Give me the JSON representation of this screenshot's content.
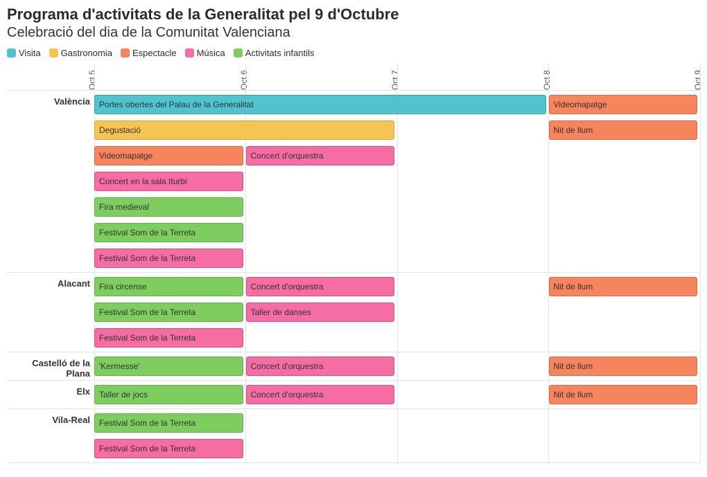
{
  "title": "Programa d'activitats de la Generalitat pel 9 d'Octubre",
  "subtitle": "Celebració del dia de la Comunitat Valenciana",
  "legend": [
    {
      "key": "Visita",
      "label": "Visita"
    },
    {
      "key": "Gastronomia",
      "label": "Gastronomia"
    },
    {
      "key": "Espectacle",
      "label": "Espectacle"
    },
    {
      "key": "Música",
      "label": "Música"
    },
    {
      "key": "Activitats",
      "label": "Activitats infantils"
    }
  ],
  "chart_data": {
    "type": "gantt",
    "x": {
      "min": 5,
      "max": 9,
      "ticks": [
        {
          "value": 5,
          "label": "Oct 5"
        },
        {
          "value": 6,
          "label": "Oct 6"
        },
        {
          "value": 7,
          "label": "Oct 7"
        },
        {
          "value": 8,
          "label": "Oct 8"
        },
        {
          "value": 9,
          "label": "Oct 9"
        }
      ]
    },
    "cities": [
      {
        "name": "València",
        "lanes": [
          [
            {
              "label": "Portes obertes del Palau de la Generalitat",
              "cat": "Visita",
              "start": 5,
              "end": 8
            },
            {
              "label": "Videomapatge",
              "cat": "Espectacle",
              "start": 8,
              "end": 9
            }
          ],
          [
            {
              "label": "Degustació",
              "cat": "Gastronomia",
              "start": 5,
              "end": 7
            },
            {
              "label": "Nit de llum",
              "cat": "Espectacle",
              "start": 8,
              "end": 9
            }
          ],
          [
            {
              "label": "Videomapatge",
              "cat": "Espectacle",
              "start": 5,
              "end": 6
            },
            {
              "label": "Concert d'orquestra",
              "cat": "Música",
              "start": 6,
              "end": 7
            }
          ],
          [
            {
              "label": "Concert en la sala Iturbi",
              "cat": "Música",
              "start": 5,
              "end": 6
            }
          ],
          [
            {
              "label": "Fira medieval",
              "cat": "Activitats",
              "start": 5,
              "end": 6
            }
          ],
          [
            {
              "label": "Festival Som de la Terreta",
              "cat": "Activitats",
              "start": 5,
              "end": 6
            }
          ],
          [
            {
              "label": "Festival Som de la Terreta",
              "cat": "Música",
              "start": 5,
              "end": 6
            }
          ]
        ]
      },
      {
        "name": "Alacant",
        "lanes": [
          [
            {
              "label": "Fira circense",
              "cat": "Activitats",
              "start": 5,
              "end": 6
            },
            {
              "label": "Concert d'orquestra",
              "cat": "Música",
              "start": 6,
              "end": 7
            },
            {
              "label": "Nit de llum",
              "cat": "Espectacle",
              "start": 8,
              "end": 9
            }
          ],
          [
            {
              "label": "Festival Som de la Terreta",
              "cat": "Activitats",
              "start": 5,
              "end": 6
            },
            {
              "label": "Taller de danses",
              "cat": "Música",
              "start": 6,
              "end": 7
            }
          ],
          [
            {
              "label": "Festival Som de la Terreta",
              "cat": "Música",
              "start": 5,
              "end": 6
            }
          ]
        ]
      },
      {
        "name": "Castelló de la Plana",
        "lanes": [
          [
            {
              "label": "'Kermesse'",
              "cat": "Activitats",
              "start": 5,
              "end": 6
            },
            {
              "label": "Concert d'orquestra",
              "cat": "Música",
              "start": 6,
              "end": 7
            },
            {
              "label": "Nit de llum",
              "cat": "Espectacle",
              "start": 8,
              "end": 9
            }
          ]
        ]
      },
      {
        "name": "Elx",
        "lanes": [
          [
            {
              "label": "Taller de jocs",
              "cat": "Activitats",
              "start": 5,
              "end": 6
            },
            {
              "label": "Concert d'orquestra",
              "cat": "Música",
              "start": 6,
              "end": 7
            },
            {
              "label": "Nit de llum",
              "cat": "Espectacle",
              "start": 8,
              "end": 9
            }
          ]
        ]
      },
      {
        "name": "Vila-Real",
        "lanes": [
          [
            {
              "label": "Festival Som de la Terreta",
              "cat": "Activitats",
              "start": 5,
              "end": 6
            }
          ],
          [
            {
              "label": "Festival Som de la Terreta",
              "cat": "Música",
              "start": 5,
              "end": 6
            }
          ]
        ]
      }
    ]
  }
}
